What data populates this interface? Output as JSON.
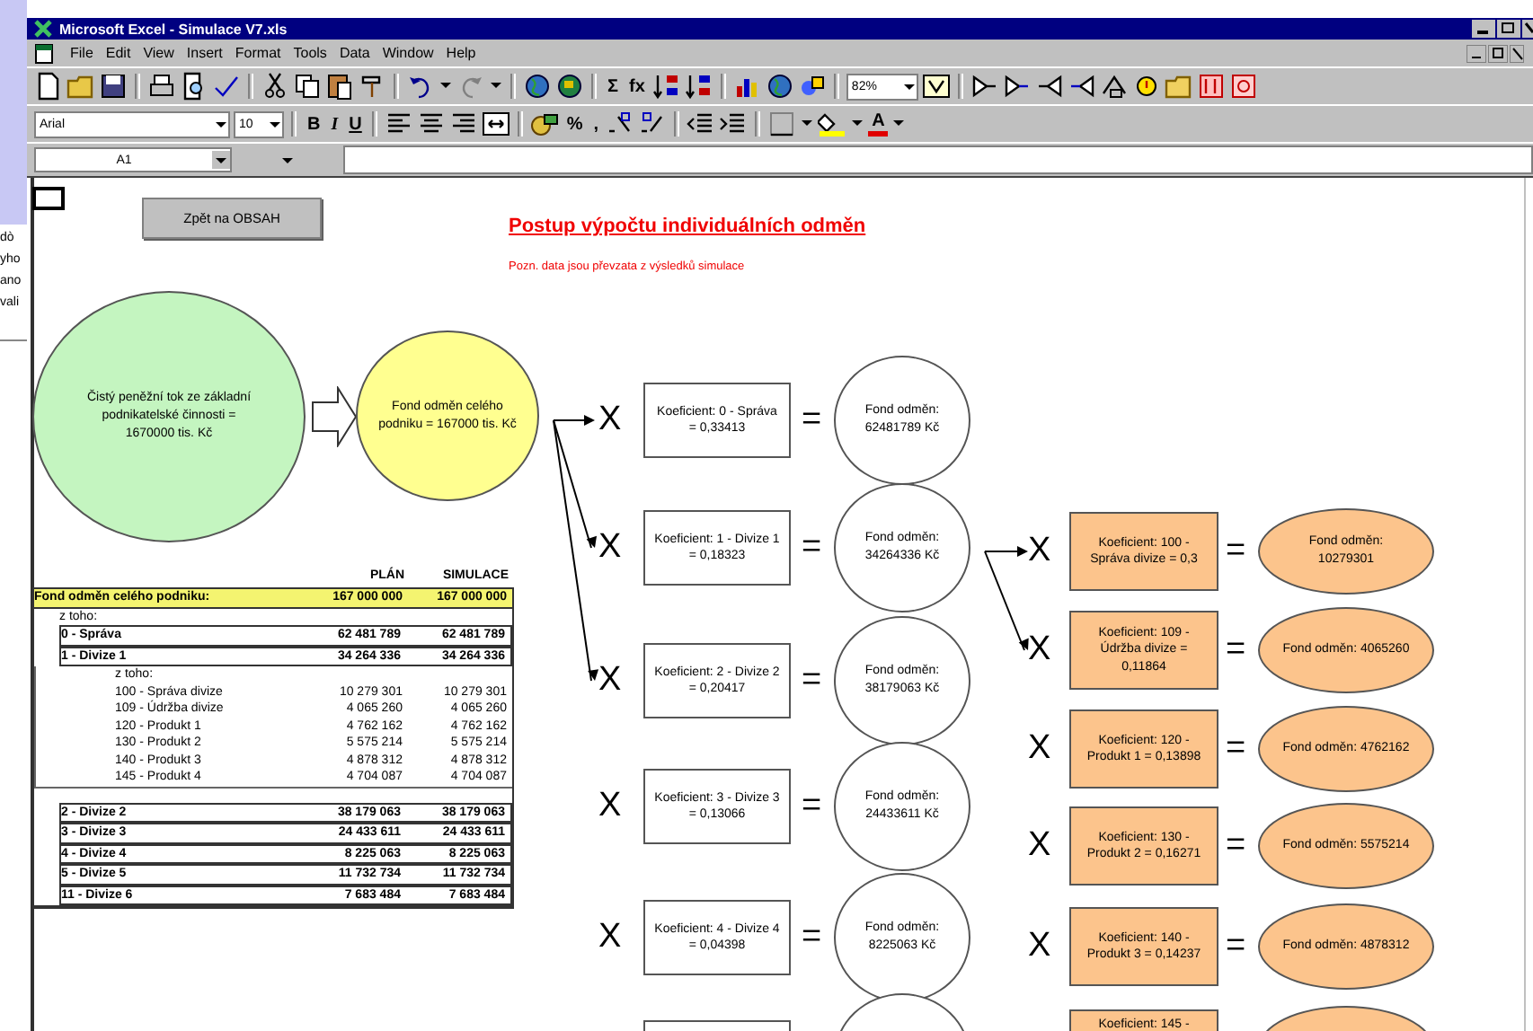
{
  "background_window": {
    "lines": [
      "dò",
      "yho",
      "ano",
      "vali"
    ]
  },
  "window": {
    "title": "Microsoft Excel - Simulace V7.xls"
  },
  "menu": [
    {
      "label": "File"
    },
    {
      "label": "Edit"
    },
    {
      "label": "View"
    },
    {
      "label": "Insert"
    },
    {
      "label": "Format"
    },
    {
      "label": "Tools"
    },
    {
      "label": "Data"
    },
    {
      "label": "Window"
    },
    {
      "label": "Help"
    }
  ],
  "standard_toolbar": {
    "glyphs": [
      "Σ",
      "fx"
    ],
    "zoom": "82%"
  },
  "formatting_toolbar": {
    "font": "Arial",
    "size": "10",
    "glyphs": [
      "B",
      "I",
      "U",
      "%",
      ",",
      "A"
    ]
  },
  "formula_bar": {
    "name_box": "A1"
  },
  "sheet": {
    "back_button": "Zpět na OBSAH",
    "heading": "Postup výpočtu individuálních odměn",
    "note": "Pozn. data jsou převzata z výsledků simulace",
    "source": "Čistý peněžní tok ze základní podnikatelské činnosti = 1670000 tis. Kč",
    "company_fund": "Fond odměn celého podniku = 167000 tis. Kč",
    "division_steps": [
      {
        "times": "X",
        "coefficient": "Koeficient: 0 - Správa = 0,33413",
        "equals": "=",
        "fund": "Fond odměn: 62481789 Kč",
        "incoming_arrow": true
      },
      {
        "times": "X",
        "coefficient": "Koeficient: 1 - Divize 1 = 0,18323",
        "equals": "=",
        "fund": "Fond odměn: 34264336 Kč",
        "incoming_arrow": true
      },
      {
        "times": "X",
        "coefficient": "Koeficient: 2 - Divize 2 = 0,20417",
        "equals": "=",
        "fund": "Fond odměn: 38179063 Kč",
        "incoming_arrow": true
      },
      {
        "times": "X",
        "coefficient": "Koeficient: 3 - Divize 3 = 0,13066",
        "equals": "=",
        "fund": "Fond odměn: 24433611 Kč",
        "incoming_arrow": false
      },
      {
        "times": "X",
        "coefficient": "Koeficient: 4 - Divize 4 = 0,04398",
        "equals": "=",
        "fund": "Fond odměn: 8225063 Kč",
        "incoming_arrow": false
      },
      {
        "incoming_arrow": false
      }
    ],
    "department_steps": [
      {
        "times": "X",
        "coefficient": "Koeficient: 100 - Správa divize = 0,3",
        "equals": "=",
        "fund": "Fond odměn: 10279301",
        "incoming_arrow": true
      },
      {
        "times": "X",
        "coefficient": "Koeficient: 109 - Údržba divize = 0,11864",
        "equals": "=",
        "fund": "Fond odměn: 4065260",
        "incoming_arrow": true
      },
      {
        "times": "X",
        "coefficient": "Koeficient: 120 - Produkt 1 = 0,13898",
        "equals": "=",
        "fund": "Fond odměn: 4762162",
        "incoming_arrow": false
      },
      {
        "times": "X",
        "coefficient": "Koeficient: 130 - Produkt 2 = 0,16271",
        "equals": "=",
        "fund": "Fond odměn: 5575214",
        "incoming_arrow": false
      },
      {
        "times": "X",
        "coefficient": "Koeficient: 140 - Produkt 3 = 0,14237",
        "equals": "=",
        "fund": "Fond odměn: 4878312",
        "incoming_arrow": false
      },
      {
        "coefficient": "Koeficient: 145 -",
        "incoming_arrow": false
      }
    ],
    "table": {
      "columns": [
        "PLÁN",
        "SIMULACE"
      ],
      "rows": [
        {
          "kind": "total",
          "label": "Fond odměn celého podniku:",
          "plan": "167 000 000",
          "simulation": "167 000 000"
        },
        {
          "kind": "caption",
          "label": "z toho:"
        },
        {
          "kind": "division",
          "label": "0 - Správa",
          "plan": "62 481 789",
          "simulation": "62 481 789"
        },
        {
          "kind": "division",
          "label": "1 - Divize 1",
          "plan": "34 264 336",
          "simulation": "34 264 336"
        },
        {
          "kind": "subcaption",
          "label": "z toho:"
        },
        {
          "kind": "item",
          "label": "100 - Správa divize",
          "plan": "10 279 301",
          "simulation": "10 279 301"
        },
        {
          "kind": "item",
          "label": "109 - Údržba divize",
          "plan": "4 065 260",
          "simulation": "4 065 260"
        },
        {
          "kind": "item",
          "label": "120 - Produkt 1",
          "plan": "4 762 162",
          "simulation": "4 762 162"
        },
        {
          "kind": "item",
          "label": "130 - Produkt 2",
          "plan": "5 575 214",
          "simulation": "5 575 214"
        },
        {
          "kind": "item",
          "label": "140 - Produkt 3",
          "plan": "4 878 312",
          "simulation": "4 878 312"
        },
        {
          "kind": "item",
          "label": "145 - Produkt 4",
          "plan": "4 704 087",
          "simulation": "4 704 087"
        },
        {
          "kind": "division",
          "label": "2 - Divize 2",
          "plan": "38 179 063",
          "simulation": "38 179 063"
        },
        {
          "kind": "division",
          "label": "3 - Divize 3",
          "plan": "24 433 611",
          "simulation": "24 433 611"
        },
        {
          "kind": "division",
          "label": "4 - Divize 4",
          "plan": "8 225 063",
          "simulation": "8 225 063"
        },
        {
          "kind": "division",
          "label": "5 - Divize 5",
          "plan": "11 732 734",
          "simulation": "11 732 734"
        },
        {
          "kind": "division",
          "label": "11 - Divize 6",
          "plan": "7 683 484",
          "simulation": "7 683 484"
        }
      ]
    }
  }
}
